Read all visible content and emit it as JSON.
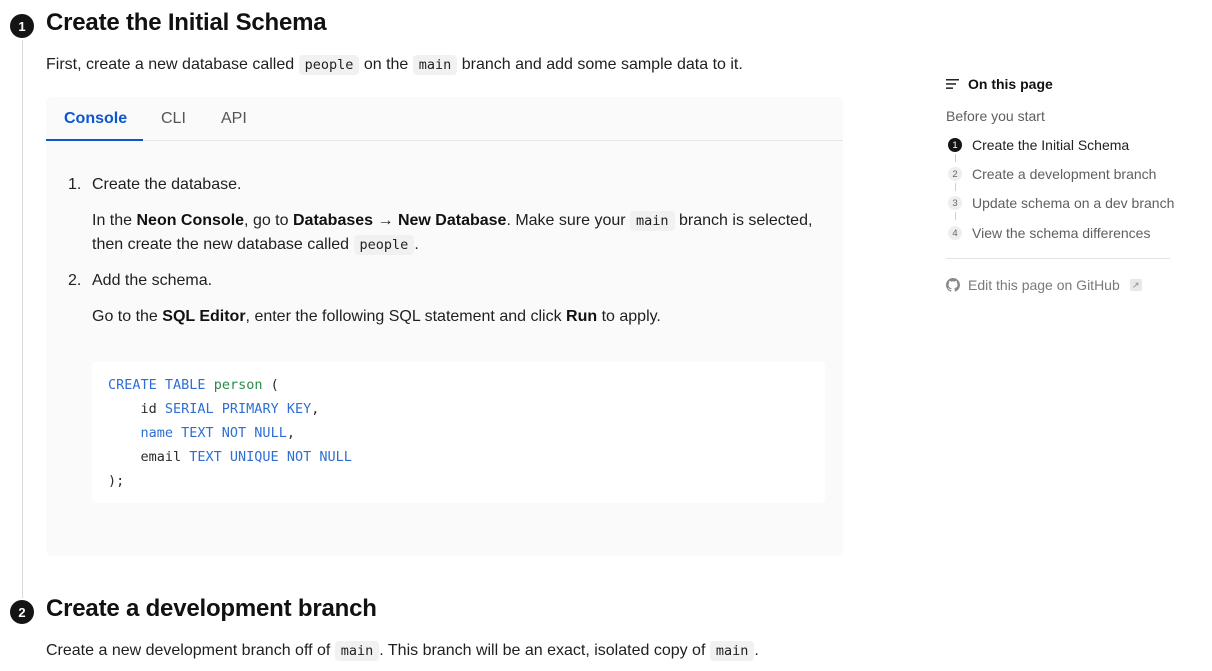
{
  "step1": {
    "number": "1",
    "title": "Create the Initial Schema",
    "intro_part1": "First, create a new database called",
    "intro_code1": "people",
    "intro_part2": "on the",
    "intro_code2": "main",
    "intro_part3": "branch and add some sample data to it."
  },
  "tabs": {
    "items": [
      "Console",
      "CLI",
      "API"
    ],
    "active": "Console"
  },
  "console_steps": {
    "item1_num": "1.",
    "item1_title": "Create the database.",
    "item1_p1": "In the",
    "item1_b1": "Neon Console",
    "item1_p2": ", go to",
    "item1_b2": "Databases",
    "item1_arrow": "→",
    "item1_b3": "New Database",
    "item1_p3": ". Make sure your",
    "item1_code1": "main",
    "item1_p4": "branch is selected,",
    "item1_p5": "then create the new database called",
    "item1_code2": "people",
    "item1_p6": ".",
    "item2_num": "2.",
    "item2_title": "Add the schema.",
    "item2_p1": "Go to the",
    "item2_b1": "SQL Editor",
    "item2_p2": ", enter the following SQL statement and click",
    "item2_b2": "Run",
    "item2_p3": "to apply."
  },
  "code": {
    "line1_kw": "CREATE TABLE",
    "line1_name": "person",
    "line1_rest": " (",
    "line2_ident": "    id ",
    "line2_kw": "SERIAL PRIMARY KEY",
    "line2_rest": ",",
    "line3_indent": "    ",
    "line3_name": "name",
    "line3_kw": " TEXT NOT NULL",
    "line3_rest": ",",
    "line4_ident": "    email ",
    "line4_kw": "TEXT UNIQUE NOT NULL",
    "line5": ");"
  },
  "step2": {
    "number": "2",
    "title": "Create a development branch",
    "p1": "Create a new development branch off of",
    "code1": "main",
    "p2": ". This branch will be an exact, isolated copy of",
    "code2": "main",
    "p3": "."
  },
  "toc": {
    "heading": "On this page",
    "before": "Before you start",
    "items": [
      {
        "num": "1",
        "label": "Create the Initial Schema"
      },
      {
        "num": "2",
        "label": "Create a development branch"
      },
      {
        "num": "3",
        "label": "Update schema on a dev branch"
      },
      {
        "num": "4",
        "label": "View the schema differences"
      }
    ],
    "edit_label": "Edit this page on GitHub"
  },
  "colors": {
    "accent": "#0b57d0",
    "keyword": "#2f6fd3",
    "type_name": "#2a8c4a"
  }
}
